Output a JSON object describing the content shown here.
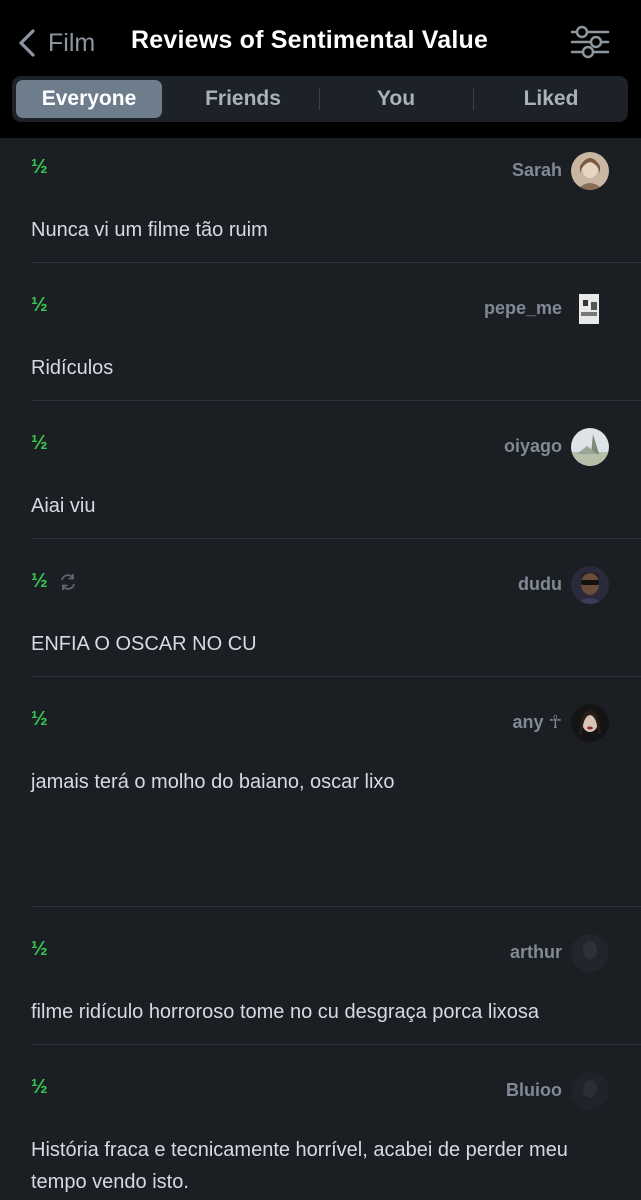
{
  "header": {
    "back_label": "Film",
    "title": "Reviews of Sentimental Value",
    "back_icon": "chevron-left-icon",
    "filter_icon": "sliders-icon"
  },
  "tabs": [
    {
      "label": "Everyone",
      "active": true
    },
    {
      "label": "Friends",
      "active": false
    },
    {
      "label": "You",
      "active": false
    },
    {
      "label": "Liked",
      "active": false
    }
  ],
  "colors": {
    "background": "#1b1e23",
    "header_bg": "#000000",
    "rating_green": "#38c44f",
    "active_tab": "#6d7d8c",
    "username": "#7f8a96"
  },
  "reviews": [
    {
      "rating": "½",
      "username": "Sarah",
      "text": "Nunca vi um filme tão ruim",
      "rewatch": false
    },
    {
      "rating": "½",
      "username": "pepe_me",
      "text": "Ridículos",
      "rewatch": false
    },
    {
      "rating": "½",
      "username": "oiyago",
      "text": "Aiai viu",
      "rewatch": false
    },
    {
      "rating": "½",
      "username": "dudu",
      "text": "ENFIA O OSCAR NO CU",
      "rewatch": true
    },
    {
      "rating": "½",
      "username": "any ☥",
      "text": "jamais terá o molho do baiano, oscar lixo",
      "rewatch": false
    },
    {
      "rating": "½",
      "username": "arthur",
      "text": "filme ridículo horroroso tome no cu desgraça porca lixosa",
      "rewatch": false
    },
    {
      "rating": "½",
      "username": "Bluioo",
      "text": "História fraca e tecnicamente horrível, acabei de perder meu tempo vendo isto.",
      "rewatch": false
    }
  ]
}
